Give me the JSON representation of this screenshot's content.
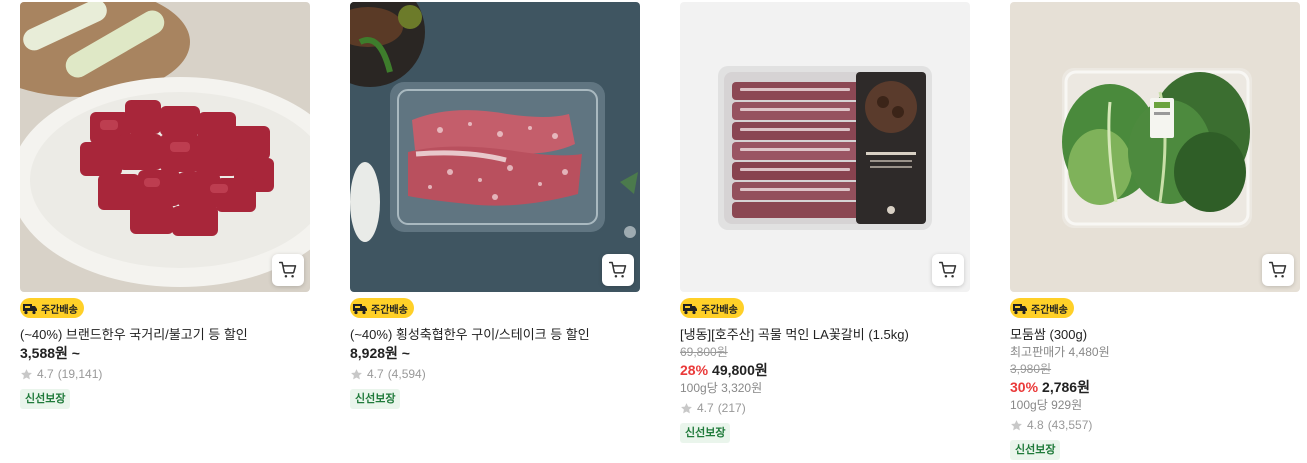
{
  "products": [
    {
      "badge": "주간배송",
      "title": "(~40%) 브랜드한우 국거리/불고기 등 할인",
      "price": "3,588원 ~",
      "rating": "4.7",
      "review_count": "(19,141)",
      "guarantee": "신선보장",
      "image": "beef-cubes-on-plate",
      "colors": {
        "bg": "#d9d3c9",
        "meat": "#a8263a"
      }
    },
    {
      "badge": "주간배송",
      "title": "(~40%) 횡성축협한우 구이/스테이크 등 할인",
      "price": "8,928원 ~",
      "rating": "4.7",
      "review_count": "(4,594)",
      "guarantee": "신선보장",
      "image": "marbled-steak-tray",
      "colors": {
        "bg": "#3f5560",
        "meat": "#c9606b"
      }
    },
    {
      "badge": "주간배송",
      "title": "[냉동][호주산] 곡물 먹인 LA꽃갈비 (1.5kg)",
      "original_price": "69,800원",
      "discount": "28%",
      "price": "49,800원",
      "unit_price": "100g당 3,320원",
      "rating": "4.7",
      "review_count": "(217)",
      "guarantee": "신선보장",
      "image": "la-galbi-package",
      "colors": {
        "bg": "#f2f2f2",
        "meat": "#8d4a55"
      }
    },
    {
      "badge": "주간배송",
      "title": "모둠쌈 (300g)",
      "max_price_label": "최고판매가 4,480원",
      "original_price": "3,980원",
      "discount": "30%",
      "price": "2,786원",
      "unit_price": "100g당 929원",
      "rating": "4.8",
      "review_count": "(43,557)",
      "guarantee": "신선보장",
      "image": "mixed-lettuce-tray",
      "colors": {
        "bg": "#e6e0d6",
        "leaf": "#3f7a34"
      }
    }
  ]
}
